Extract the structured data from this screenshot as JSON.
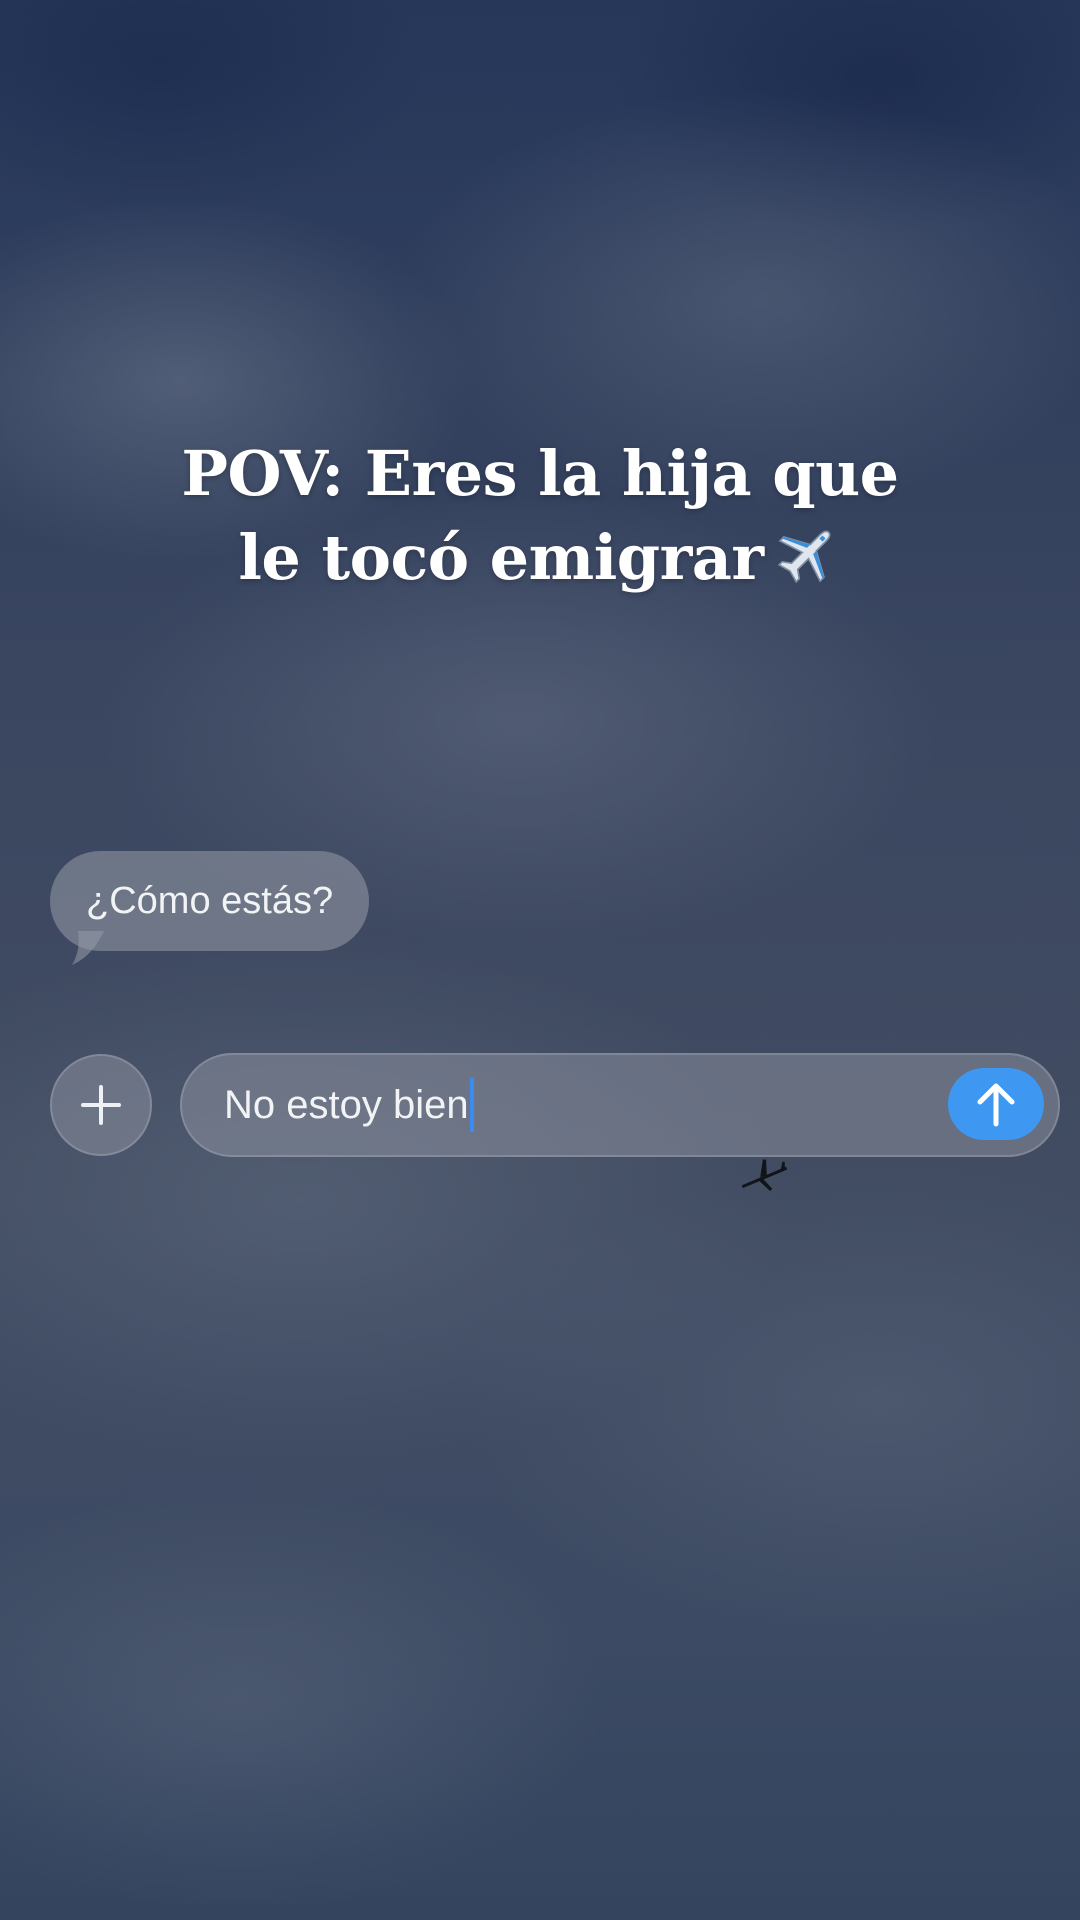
{
  "headline": {
    "line1": "POV: Eres la hija que",
    "line2": "le tocó emigrar",
    "emoji_icon": "airplane-icon"
  },
  "received_message": {
    "text": "¿Cómo estás?"
  },
  "composer": {
    "plus_icon": "plus-icon",
    "input_value": "No estoy bien",
    "send_icon": "arrow-up-icon",
    "send_color": "#3e98f2"
  },
  "background": {
    "description_icon": "airplane-silhouette-icon"
  }
}
